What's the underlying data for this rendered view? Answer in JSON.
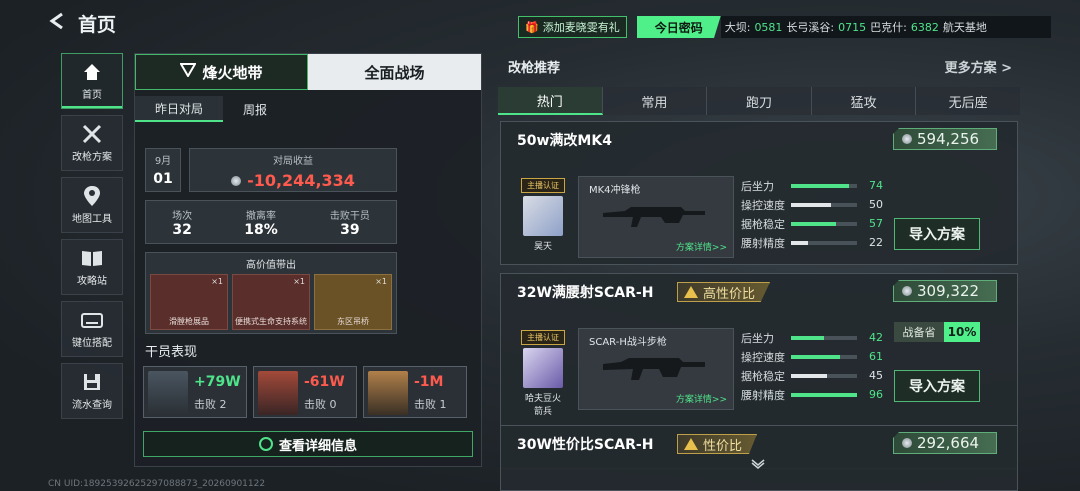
{
  "header": {
    "title": "首页",
    "gift_label": "添加麦晓雯有礼",
    "daily_pwd": "今日密码",
    "codes": [
      {
        "name": "大坝:",
        "code": "0581"
      },
      {
        "name": "长弓溪谷:",
        "code": "0715"
      },
      {
        "name": "巴克什:",
        "code": "6382"
      },
      {
        "name": "航天基地"
      }
    ]
  },
  "sidebar": {
    "items": [
      "首页",
      "改枪方案",
      "地图工具",
      "攻略站",
      "键位搭配",
      "流水查询"
    ]
  },
  "left": {
    "modes": [
      "烽火地带",
      "全面战场"
    ],
    "subtabs": [
      "昨日对局",
      "周报"
    ],
    "date": {
      "month": "9月",
      "day": "01"
    },
    "income": {
      "label": "对局收益",
      "value": "-10,244,334"
    },
    "stats": [
      {
        "label": "场次",
        "value": "32"
      },
      {
        "label": "撤离率",
        "value": "18%"
      },
      {
        "label": "击败干员",
        "value": "39"
      }
    ],
    "loot": {
      "title": "高价值带出",
      "items": [
        {
          "name": "滑膛枪展品",
          "count": "×1"
        },
        {
          "name": "便携式生命支持系统",
          "count": "×1"
        },
        {
          "name": "东区吊桥",
          "count": "×1"
        }
      ]
    },
    "ops_title": "干员表现",
    "ops": [
      {
        "value": "+79W",
        "kills": "击败 2"
      },
      {
        "value": "-61W",
        "kills": "击败 0"
      },
      {
        "value": "-1M",
        "kills": "击败 1"
      }
    ],
    "detail_btn": "查看详细信息"
  },
  "right": {
    "title": "改枪推荐",
    "more": "更多方案 >",
    "tabs": [
      "热门",
      "常用",
      "跑刀",
      "猛攻",
      "无后座"
    ],
    "stat_labels": [
      "后坐力",
      "操控速度",
      "据枪稳定",
      "腰射精度"
    ],
    "import": "导入方案",
    "guns": [
      {
        "name": "50w满改MK4",
        "price": "594,256",
        "badge": "主播认证",
        "streamer": "昊天",
        "weapon": "MK4冲锋枪",
        "detail": "方案详情>>",
        "stats": [
          "74",
          "50",
          "57",
          "22"
        ]
      },
      {
        "name": "32W满腰射SCAR-H",
        "tag": "高性价比",
        "price": "309,322",
        "badge": "主播认证",
        "streamer": "哈夫豆火箭兵",
        "weapon": "SCAR-H战斗步枪",
        "detail": "方案详情>>",
        "stats": [
          "42",
          "61",
          "45",
          "96"
        ],
        "save_label": "战备省",
        "save_value": "10%"
      },
      {
        "name": "30W性价比SCAR-H",
        "tag": "性价比",
        "price": "292,664"
      }
    ]
  },
  "footer": {
    "uid": "CN UID:18925392625297088873_20260901122"
  }
}
